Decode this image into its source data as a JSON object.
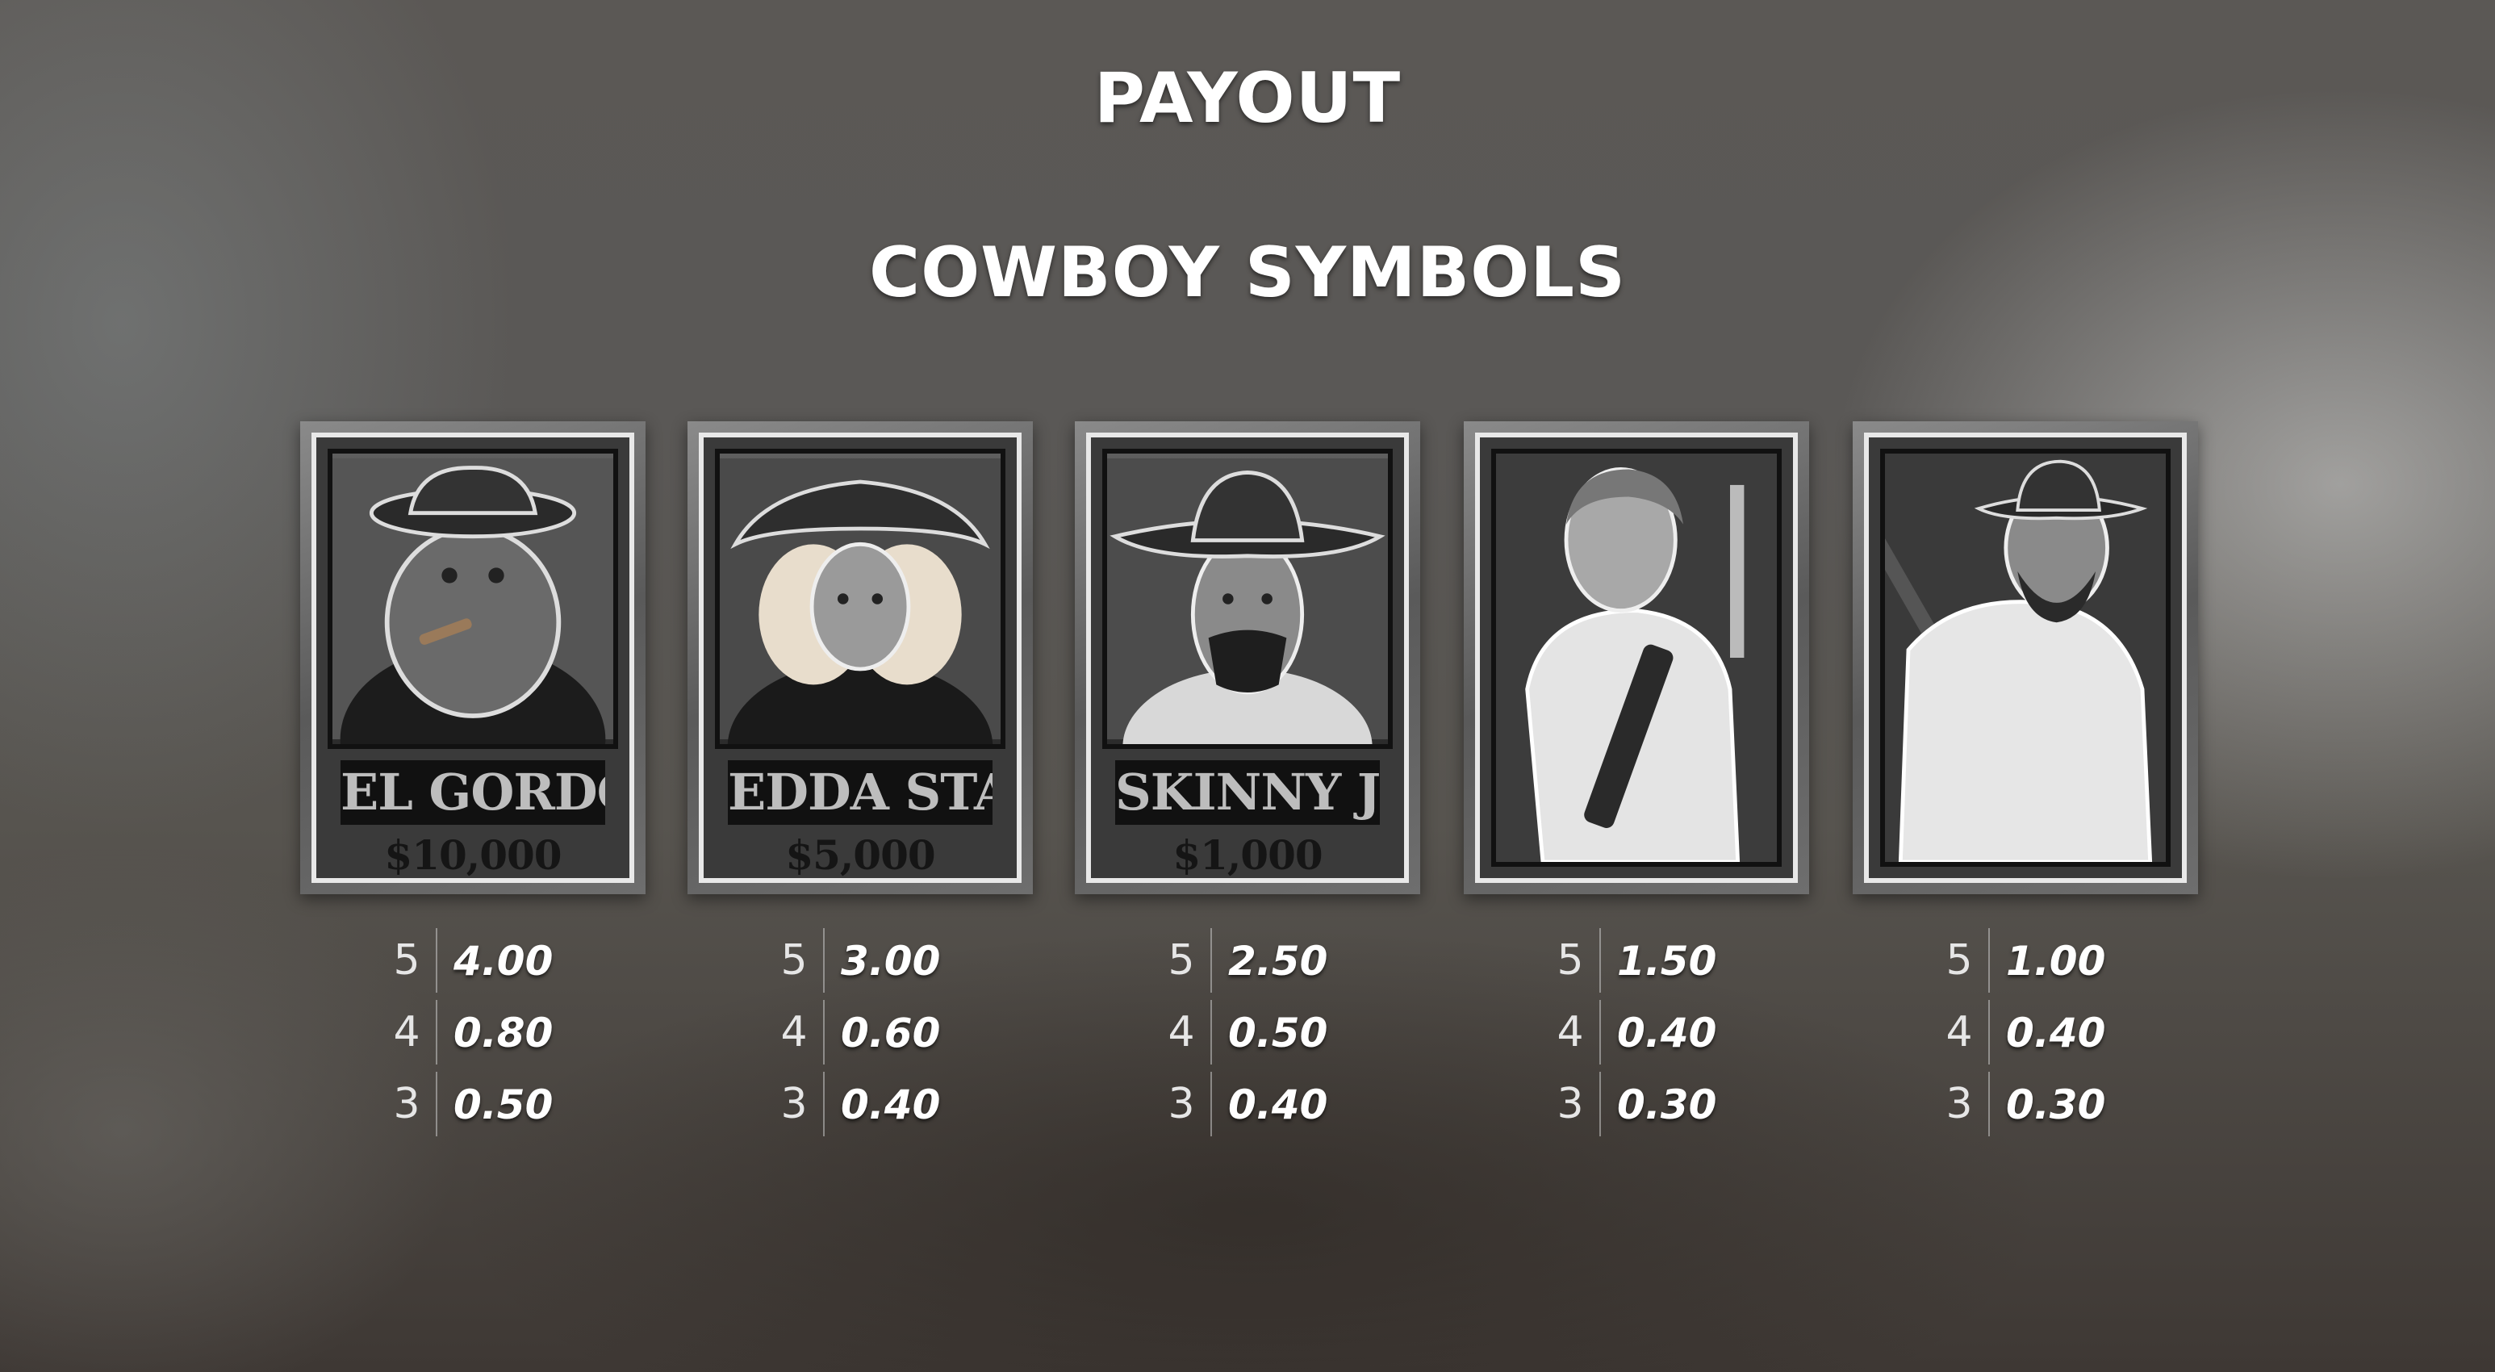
{
  "header": {
    "title": "PAYOUT",
    "subtitle": "COWBOY SYMBOLS"
  },
  "symbols": [
    {
      "name": "EL GORDO",
      "bounty": "$10,000",
      "icon": "el-gordo-portrait",
      "payouts": [
        {
          "count": "5",
          "value": "4.00"
        },
        {
          "count": "4",
          "value": "0.80"
        },
        {
          "count": "3",
          "value": "0.50"
        }
      ]
    },
    {
      "name": "EDDA STAR",
      "bounty": "$5,000",
      "icon": "edda-star-portrait",
      "payouts": [
        {
          "count": "5",
          "value": "3.00"
        },
        {
          "count": "4",
          "value": "0.60"
        },
        {
          "count": "3",
          "value": "0.40"
        }
      ]
    },
    {
      "name": "SKINNY JOE",
      "bounty": "$1,000",
      "icon": "skinny-joe-portrait",
      "payouts": [
        {
          "count": "5",
          "value": "2.50"
        },
        {
          "count": "4",
          "value": "0.50"
        },
        {
          "count": "3",
          "value": "0.40"
        }
      ]
    },
    {
      "icon": "gunslinger-woman-portrait",
      "payouts": [
        {
          "count": "5",
          "value": "1.50"
        },
        {
          "count": "4",
          "value": "0.40"
        },
        {
          "count": "3",
          "value": "0.30"
        }
      ]
    },
    {
      "icon": "bearded-cowboy-portrait",
      "payouts": [
        {
          "count": "5",
          "value": "1.00"
        },
        {
          "count": "4",
          "value": "0.40"
        },
        {
          "count": "3",
          "value": "0.30"
        }
      ]
    }
  ]
}
